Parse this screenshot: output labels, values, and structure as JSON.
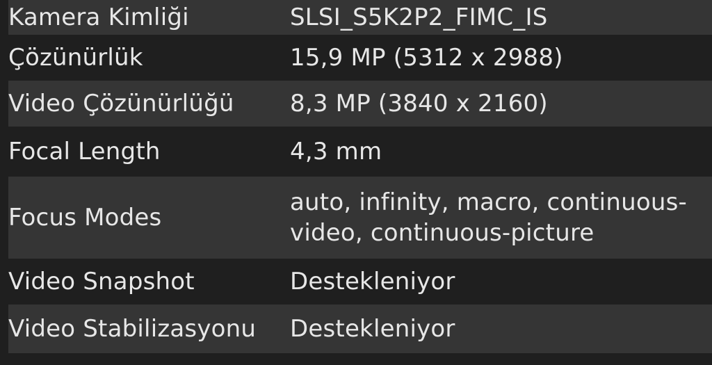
{
  "camera_specs": {
    "rows": [
      {
        "label": "Kamera Kimliği",
        "value": "SLSI_S5K2P2_FIMC_IS"
      },
      {
        "label": "Çözünürlük",
        "value": "15,9 MP (5312 x 2988)"
      },
      {
        "label": "Video Çözünürlüğü",
        "value": "8,3 MP (3840 x 2160)"
      },
      {
        "label": "Focal Length",
        "value": "4,3 mm"
      },
      {
        "label": "Focus Modes",
        "value": "auto, infinity, macro, continuous-video, continuous-picture"
      },
      {
        "label": "Video Snapshot",
        "value": "Destekleniyor"
      },
      {
        "label": "Video Stabilizasyonu",
        "value": "Destekleniyor"
      }
    ]
  },
  "colors": {
    "background": "#1f1f1f",
    "row_alt": "#353535",
    "text": "#e7e7e7"
  }
}
